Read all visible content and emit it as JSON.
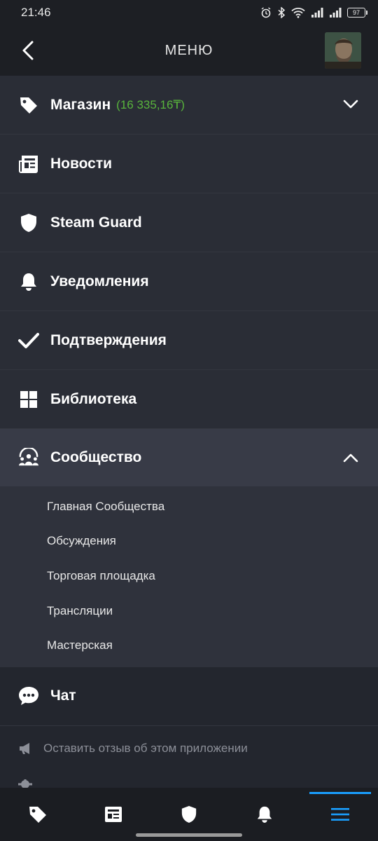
{
  "status_bar": {
    "time": "21:46",
    "battery": "97"
  },
  "header": {
    "title": "МЕНЮ"
  },
  "menu": {
    "store_label": "Магазин",
    "store_balance": "(16 335,16₸)",
    "news_label": "Новости",
    "guard_label": "Steam Guard",
    "notifications_label": "Уведомления",
    "confirmations_label": "Подтверждения",
    "library_label": "Библиотека",
    "community_label": "Сообщество",
    "community_items": [
      "Главная Сообщества",
      "Обсуждения",
      "Торговая площадка",
      "Трансляции",
      "Мастерская"
    ],
    "chat_label": "Чат"
  },
  "footer": {
    "feedback_label": "Оставить отзыв об этом приложении"
  },
  "bottom_nav": {
    "active": "menu"
  },
  "colors": {
    "accent": "#1a9fff",
    "balance": "#58b43c",
    "background": "#23262e",
    "item_bg": "#2a2d36"
  }
}
